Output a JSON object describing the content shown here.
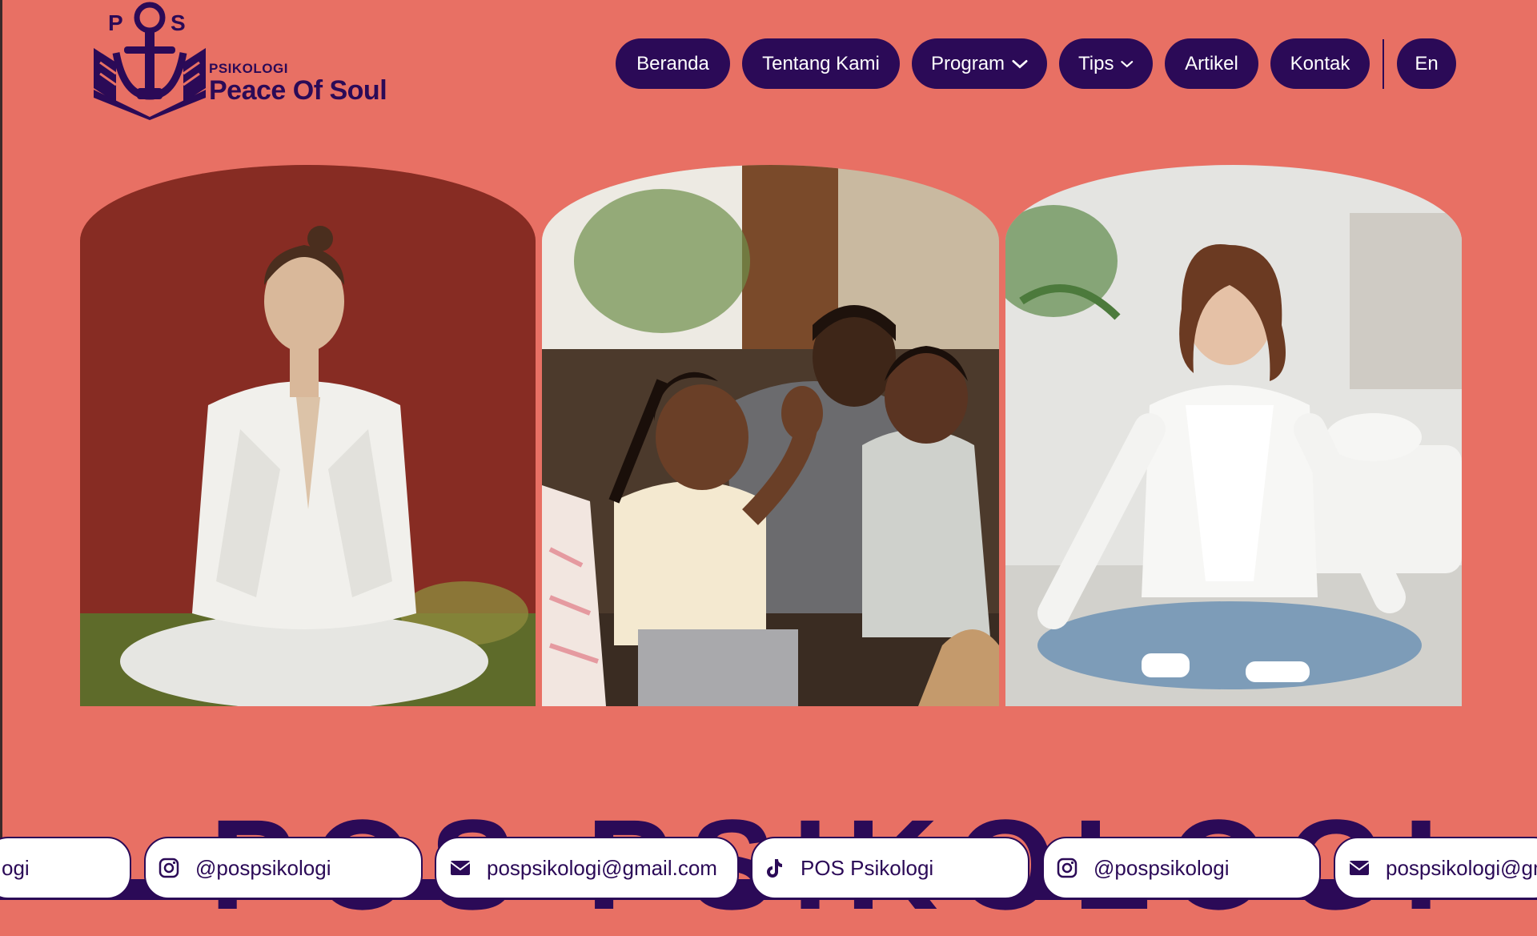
{
  "brand": {
    "logo_letters": "POS",
    "tagline": "PSIKOLOGI",
    "name": "Peace Of Soul"
  },
  "nav": {
    "items": [
      {
        "label": "Beranda"
      },
      {
        "label": "Tentang Kami"
      },
      {
        "label": "Program"
      },
      {
        "label": "Tips"
      },
      {
        "label": "Artikel"
      },
      {
        "label": "Kontak"
      }
    ],
    "language": "En"
  },
  "hero": {
    "images": [
      {
        "alt": "Woman meditating in prayer pose"
      },
      {
        "alt": "Family with children high-fiving on sofa"
      },
      {
        "alt": "Woman meditating cross-legged at home"
      }
    ],
    "heading": "POS PSIKOLOGI"
  },
  "contacts": {
    "instagram": "@pospsikologi",
    "email": "pospsikologi@gmail.com",
    "tiktok": "POS Psikologi",
    "partial_left": "ogi",
    "partial_right": "pospsikologi@gm"
  },
  "colors": {
    "background": "#E87064",
    "primary": "#2B0A57",
    "chip_bg": "#FFFFFF"
  },
  "icons": [
    "instagram-icon",
    "mail-icon",
    "tiktok-icon",
    "chevron-down-icon"
  ]
}
